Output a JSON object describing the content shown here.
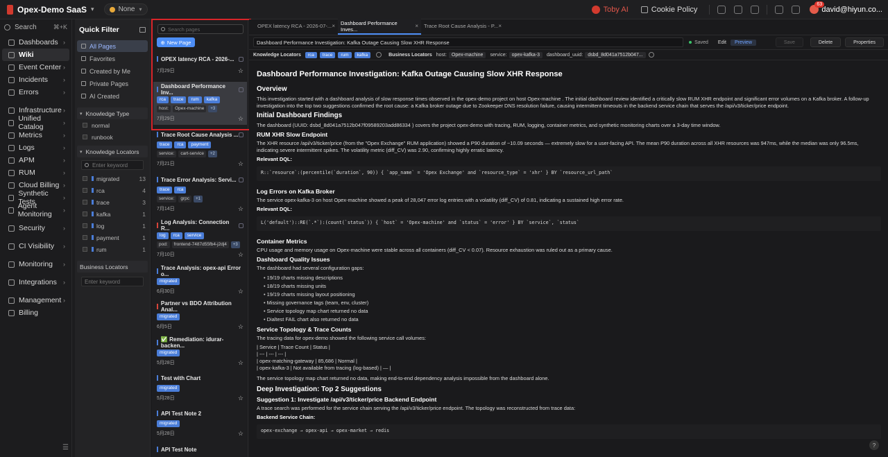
{
  "topbar": {
    "org_name": "Opex-Demo SaaS",
    "workspace": "None",
    "toby_ai": "Toby AI",
    "cookie_policy": "Cookie Policy",
    "user_name": "david@hiyun.co...",
    "notification_count": "63"
  },
  "leftnav": {
    "search_label": "Search",
    "search_shortcut": "⌘+K",
    "items": [
      {
        "label": "Dashboards"
      },
      {
        "label": "Wiki"
      },
      {
        "label": "Event Center"
      },
      {
        "label": "Incidents"
      },
      {
        "label": "Errors"
      },
      {
        "label": "Infrastructure"
      },
      {
        "label": "Unified Catalog"
      },
      {
        "label": "Metrics"
      },
      {
        "label": "Logs"
      },
      {
        "label": "APM"
      },
      {
        "label": "RUM"
      },
      {
        "label": "Cloud Billing"
      },
      {
        "label": "Synthetic Tests"
      },
      {
        "label": "Agent Monitoring"
      },
      {
        "label": "Security"
      },
      {
        "label": "CI Visibility"
      },
      {
        "label": "Monitoring"
      },
      {
        "label": "Integrations"
      },
      {
        "label": "Management"
      },
      {
        "label": "Billing"
      }
    ]
  },
  "quickfilter": {
    "title": "Quick Filter",
    "items": [
      {
        "label": "All Pages"
      },
      {
        "label": "Favorites"
      },
      {
        "label": "Created by Me"
      },
      {
        "label": "Private Pages"
      },
      {
        "label": "AI Created"
      }
    ],
    "knowledge_type": {
      "title": "Knowledge Type",
      "rows": [
        {
          "label": "normal"
        },
        {
          "label": "runbook"
        }
      ]
    },
    "knowledge_locators": {
      "title": "Knowledge Locators",
      "placeholder": "Enter keyword",
      "rows": [
        {
          "label": "migrated",
          "count": "13"
        },
        {
          "label": "rca",
          "count": "4"
        },
        {
          "label": "trace",
          "count": "3"
        },
        {
          "label": "kafka",
          "count": "1"
        },
        {
          "label": "log",
          "count": "1"
        },
        {
          "label": "payment",
          "count": "1"
        },
        {
          "label": "rum",
          "count": "1"
        }
      ]
    },
    "business_locators": {
      "title": "Business Locators",
      "placeholder": "Enter keyword"
    }
  },
  "pagelist": {
    "search_placeholder": "Search pages",
    "new_page": "New Page",
    "cards": [
      {
        "title": "OPEX latency RCA - 2026-...",
        "tags": [],
        "meta": [],
        "extra": "",
        "date": "7月29日"
      },
      {
        "title": "Dashboard Performance Inv...",
        "tags": [
          "rca",
          "trace",
          "rum",
          "kafka"
        ],
        "meta": [
          "host:",
          "Opex-machine"
        ],
        "extra": "+3",
        "date": "7月29日"
      },
      {
        "title": "Trace Root Cause Analysis ...",
        "tags": [
          "trace",
          "rca",
          "payment"
        ],
        "meta": [
          "service:",
          "cart-service"
        ],
        "extra": "+2",
        "date": "7月21日"
      },
      {
        "title": "Trace Error Analysis: Servi...",
        "tags": [
          "trace",
          "rca"
        ],
        "meta": [
          "service:",
          "grpc"
        ],
        "extra": "+1",
        "date": "7月14日"
      },
      {
        "title": "Log Analysis: Connection R...",
        "tags": [
          "log",
          "rca",
          "service"
        ],
        "meta": [
          "pod:",
          "frontend-7487d55fb4-j2dj4"
        ],
        "extra": "+3",
        "date": "7月10日"
      },
      {
        "title": "Trace Analysis: opex-api Error o...",
        "tags": [
          "migrated"
        ],
        "meta": [],
        "extra": "",
        "date": "6月30日"
      },
      {
        "title": "Partner vs BDO Attribution Anal...",
        "tags": [
          "migrated"
        ],
        "meta": [],
        "extra": "",
        "date": "6月5日"
      },
      {
        "title": "✅ Remediation: idurar-backen...",
        "tags": [
          "migrated"
        ],
        "meta": [],
        "extra": "",
        "date": "5月28日"
      },
      {
        "title": "Test with Chart",
        "tags": [
          "migrated"
        ],
        "meta": [],
        "extra": "",
        "date": "5月28日"
      },
      {
        "title": "API Test Note 2",
        "tags": [
          "migrated"
        ],
        "meta": [],
        "extra": "",
        "date": "5月28日"
      },
      {
        "title": "API Test Note",
        "tags": [],
        "meta": [],
        "extra": "",
        "date": ""
      }
    ]
  },
  "tabs": [
    {
      "label": "OPEX latency RCA - 2026-07-..."
    },
    {
      "label": "Dashboard Performance Inves..."
    },
    {
      "label": "Trace Root Cause Analysis - P..."
    }
  ],
  "editor": {
    "title": "Dashboard Performance Investigation: Kafka Outage Causing Slow XHR Response",
    "saved": "Saved",
    "edit": "Edit",
    "preview": "Preview",
    "save": "Save",
    "delete": "Delete",
    "properties": "Properties",
    "knowledge_locators_label": "Knowledge Locators",
    "knowledge_tags": [
      "rca",
      "trace",
      "rum",
      "kafka"
    ],
    "business_locators_label": "Business Locators",
    "business": [
      {
        "k": "host:",
        "v": "Opex-machine"
      },
      {
        "k": "service:",
        "v": "opex-kafka-3"
      },
      {
        "k": "dashboard_uuid:",
        "v": "dsbd_8d041a7512b047..."
      }
    ]
  },
  "doc": {
    "h1": "Dashboard Performance Investigation: Kafka Outage Causing Slow XHR Response",
    "overview_h": "Overview",
    "overview_p": "This investigation started with a dashboard analysis of slow response times observed in the opex-demo project on host Opex-machine . The initial dashboard review identified a critically slow RUM XHR endpoint and significant error volumes on a Kafka broker. A follow-up investigation into the top two suggestions confirmed the root cause: a Kafka broker outage due to Zookeeper DNS resolution failure, causing intermittent timeouts in the backend service chain that serves the /api/v3/ticker/price endpoint.",
    "findings_h": "Initial Dashboard Findings",
    "findings_p": "The dashboard (UUID: dsbd_8d041a7512b047f09589203add86334 ) covers the project opex-demo with tracing, RUM, logging, container metrics, and synthetic monitoring charts over a 3-day time window.",
    "rum_h": "RUM XHR Slow Endpoint",
    "rum_p": "The XHR resource /api/v3/ticker/price (from the \"Opex Exchange\" RUM application) showed a P90 duration of ~10.09 seconds — extremely slow for a user-facing API. The mean P90 duration across all XHR resources was 947ms, while the median was only 96.5ms, indicating severe intermittent spikes. The volatility metric (diff_CV) was 2.90, confirming highly erratic latency.",
    "dql_label": "Relevant DQL:",
    "rum_dql": "R::`resource`:(percentile(`duration`, 90)) { `app_name` = 'Opex Exchange' and `resource_type` = 'xhr' } BY `resource_url_path`",
    "log_h": "Log Errors on Kafka Broker",
    "log_p": "The service opex-kafka-3 on host Opex-machine showed a peak of 28,047 error log entries with a volatility (diff_CV) of 0.81, indicating a sustained high error rate.",
    "log_dql": "L('default')::RE(`.*`):(count(`status`)) { `host` = 'Opex-machine' and `status` = 'error' } BY `service`, `status`",
    "container_h": "Container Metrics",
    "container_p": "CPU usage and memory usage on Opex-machine were stable across all containers (diff_CV < 0.07). Resource exhaustion was ruled out as a primary cause.",
    "quality_h": "Dashboard Quality Issues",
    "quality_p": "The dashboard had several configuration gaps:",
    "quality_items": [
      "19/19 charts missing descriptions",
      "18/19 charts missing units",
      "19/19 charts missing layout positioning",
      "Missing governance tags (team, env, cluster)",
      "Service topology map chart returned no data",
      "Dialtest FAIL chart also returned no data"
    ],
    "topo_h": "Service Topology & Trace Counts",
    "topo_p": "The tracing data for opex-demo showed the following service call volumes:",
    "topo_table": [
      "| Service | Trace Count | Status |",
      "| --- | --- | --- |",
      "| opex-matching-gateway | 85,686 | Normal |",
      "| opex-kafka-3 | Not available from tracing (log-based) | — |"
    ],
    "topo_p2": "The service topology map chart returned no data, making end-to-end dependency analysis impossible from the dashboard alone.",
    "deep_h": "Deep Investigation: Top 2 Suggestions",
    "sug1_h": "Suggestion 1: Investigate /api/v3/ticker/price Backend Endpoint",
    "sug1_p": "A trace search was performed for the service chain serving the /api/v3/ticker/price endpoint. The topology was reconstructed from trace data:",
    "chain_label": "Backend Service Chain:",
    "chain": "opex-exchange → opex-api → opex-market → redis"
  },
  "help": "?"
}
